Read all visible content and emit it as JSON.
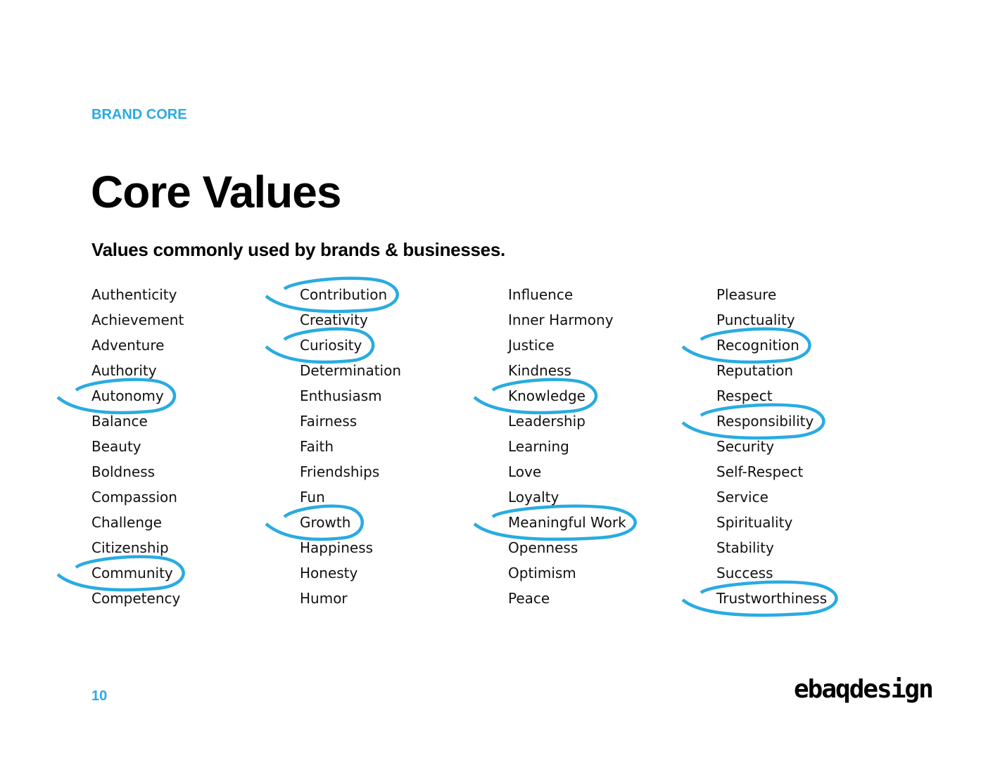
{
  "header": {
    "eyebrow": "BRAND CORE",
    "title": "Core Values",
    "subtitle": "Values commonly used by brands & businesses."
  },
  "accent_color": "#29abe2",
  "columns": [
    [
      "Authenticity",
      "Achievement",
      "Adventure",
      "Authority",
      "Autonomy",
      "Balance",
      "Beauty",
      "Boldness",
      "Compassion",
      "Challenge",
      "Citizenship",
      "Community",
      "Competency"
    ],
    [
      "Contribution",
      "Creativity",
      "Curiosity",
      "Determination",
      "Enthusiasm",
      "Fairness",
      "Faith",
      "Friendships",
      "Fun",
      "Growth",
      "Happiness",
      "Honesty",
      "Humor"
    ],
    [
      "Influence",
      "Inner Harmony",
      "Justice",
      "Kindness",
      "Knowledge",
      "Leadership",
      "Learning",
      "Love",
      "Loyalty",
      "Meaningful Work",
      "Openness",
      "Optimism",
      "Peace"
    ],
    [
      "Pleasure",
      "Punctuality",
      "Recognition",
      "Reputation",
      "Respect",
      "Responsibility",
      "Security",
      "Self-Respect",
      "Service",
      "Spirituality",
      "Stability",
      "Success",
      "Trustworthiness"
    ]
  ],
  "circled": [
    {
      "col": 0,
      "row": 4
    },
    {
      "col": 0,
      "row": 11
    },
    {
      "col": 1,
      "row": 0
    },
    {
      "col": 1,
      "row": 2
    },
    {
      "col": 1,
      "row": 9
    },
    {
      "col": 2,
      "row": 4
    },
    {
      "col": 2,
      "row": 9
    },
    {
      "col": 3,
      "row": 2
    },
    {
      "col": 3,
      "row": 5
    },
    {
      "col": 3,
      "row": 12
    }
  ],
  "footer": {
    "page_number": "10",
    "logo_text": "ebaqdesign"
  }
}
